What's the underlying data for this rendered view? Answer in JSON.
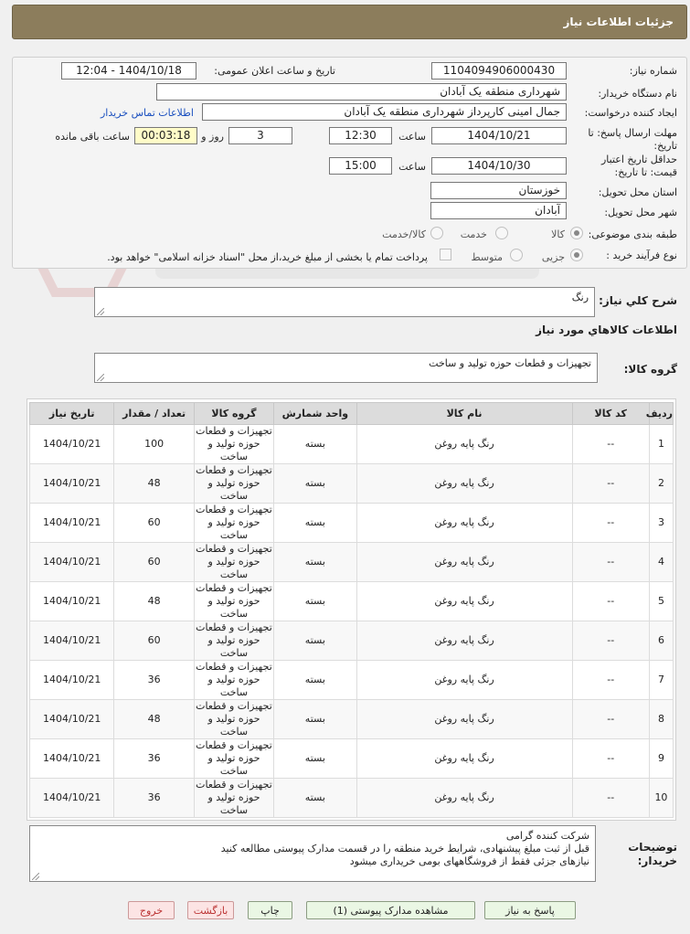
{
  "title": "جزئیات اطلاعات نیاز",
  "form": {
    "need_number_label": "شماره نیاز:",
    "need_number": "1104094906000430",
    "announce_label": "تاریخ و ساعت اعلان عمومی:",
    "announce_value": "1404/10/18 - 12:04",
    "buyer_org_label": "نام دستگاه خریدار:",
    "buyer_org": "شهرداری منطقه یک آبادان",
    "creator_label": "ایجاد کننده درخواست:",
    "creator": "جمال امینی کارپرداز شهرداری منطقه یک آبادان",
    "contact_link": "اطلاعات تماس خریدار",
    "deadline_label_1": "مهلت ارسال پاسخ: تا",
    "deadline_label_2": "تاریخ:",
    "deadline_date": "1404/10/21",
    "time_label": "ساعت",
    "deadline_time": "12:30",
    "days_value": "3",
    "days_label": "روز و",
    "remaining_value": "00:03:18",
    "remaining_label": "ساعت باقی مانده",
    "validity_label_1": "حداقل تاریخ اعتبار",
    "validity_label_2": "قیمت: تا تاریخ:",
    "validity_date": "1404/10/30",
    "validity_time": "15:00",
    "province_label": "استان محل تحویل:",
    "province": "خوزستان",
    "city_label": "شهر محل تحویل:",
    "city": "آبادان",
    "category_label": "طبقه بندی موضوعی:",
    "category_options": [
      "کالا",
      "خدمت",
      "کالا/خدمت"
    ],
    "process_label": "نوع فرآیند خرید :",
    "process_options": [
      "جزیی",
      "متوسط"
    ],
    "payment_note": "پرداخت تمام یا بخشی از مبلغ خرید،از محل \"اسناد خزانه اسلامی\" خواهد بود."
  },
  "summary": {
    "label": "شرح كلي نياز:",
    "value": "رنگ"
  },
  "goods_info_label": "اطلاعات كالاهاي مورد نياز",
  "goods_group": {
    "label": "گروه کالا:",
    "value": "تجهیزات و قطعات حوزه تولید و ساخت"
  },
  "table": {
    "headers": [
      "ردیف",
      "کد کالا",
      "نام کالا",
      "واحد شمارش",
      "گروه کالا",
      "تعداد / مقدار",
      "تاریخ نیاز"
    ],
    "rows": [
      [
        "1",
        "--",
        "رنگ پایه روغن",
        "بسته",
        "تجهیزات و قطعات حوزه تولید و ساخت",
        "100",
        "1404/10/21"
      ],
      [
        "2",
        "--",
        "رنگ پایه روغن",
        "بسته",
        "تجهیزات و قطعات حوزه تولید و ساخت",
        "48",
        "1404/10/21"
      ],
      [
        "3",
        "--",
        "رنگ پایه روغن",
        "بسته",
        "تجهیزات و قطعات حوزه تولید و ساخت",
        "60",
        "1404/10/21"
      ],
      [
        "4",
        "--",
        "رنگ پایه روغن",
        "بسته",
        "تجهیزات و قطعات حوزه تولید و ساخت",
        "60",
        "1404/10/21"
      ],
      [
        "5",
        "--",
        "رنگ پایه روغن",
        "بسته",
        "تجهیزات و قطعات حوزه تولید و ساخت",
        "48",
        "1404/10/21"
      ],
      [
        "6",
        "--",
        "رنگ پایه روغن",
        "بسته",
        "تجهیزات و قطعات حوزه تولید و ساخت",
        "60",
        "1404/10/21"
      ],
      [
        "7",
        "--",
        "رنگ پایه روغن",
        "بسته",
        "تجهیزات و قطعات حوزه تولید و ساخت",
        "36",
        "1404/10/21"
      ],
      [
        "8",
        "--",
        "رنگ پایه روغن",
        "بسته",
        "تجهیزات و قطعات حوزه تولید و ساخت",
        "48",
        "1404/10/21"
      ],
      [
        "9",
        "--",
        "رنگ پایه روغن",
        "بسته",
        "تجهیزات و قطعات حوزه تولید و ساخت",
        "36",
        "1404/10/21"
      ],
      [
        "10",
        "--",
        "رنگ پایه روغن",
        "بسته",
        "تجهیزات و قطعات حوزه تولید و ساخت",
        "36",
        "1404/10/21"
      ]
    ]
  },
  "buyer_notes": {
    "label_1": "توضیحات",
    "label_2": "خریدار:",
    "lines": [
      "شرکت کننده گرامی",
      "قبل از ثبت مبلغ پیشنهادی، شرایط خرید منطقه را در قسمت مدارک پیوستی مطالعه کنید",
      "نیازهای جزئی فقط از فروشگاههای بومی خریداری میشود"
    ]
  },
  "buttons": {
    "reply": "پاسخ به نیاز",
    "attachments": "مشاهده مدارک پیوستی (1)",
    "print": "چاپ",
    "back": "بازگشت",
    "exit": "خروج"
  },
  "colors": {
    "title_bar": "#8c7d5c",
    "link": "#1a4fbf",
    "remaining_bg": "#fffcc8",
    "button_bg": "#eaf7e4",
    "danger_text": "#b33333"
  }
}
